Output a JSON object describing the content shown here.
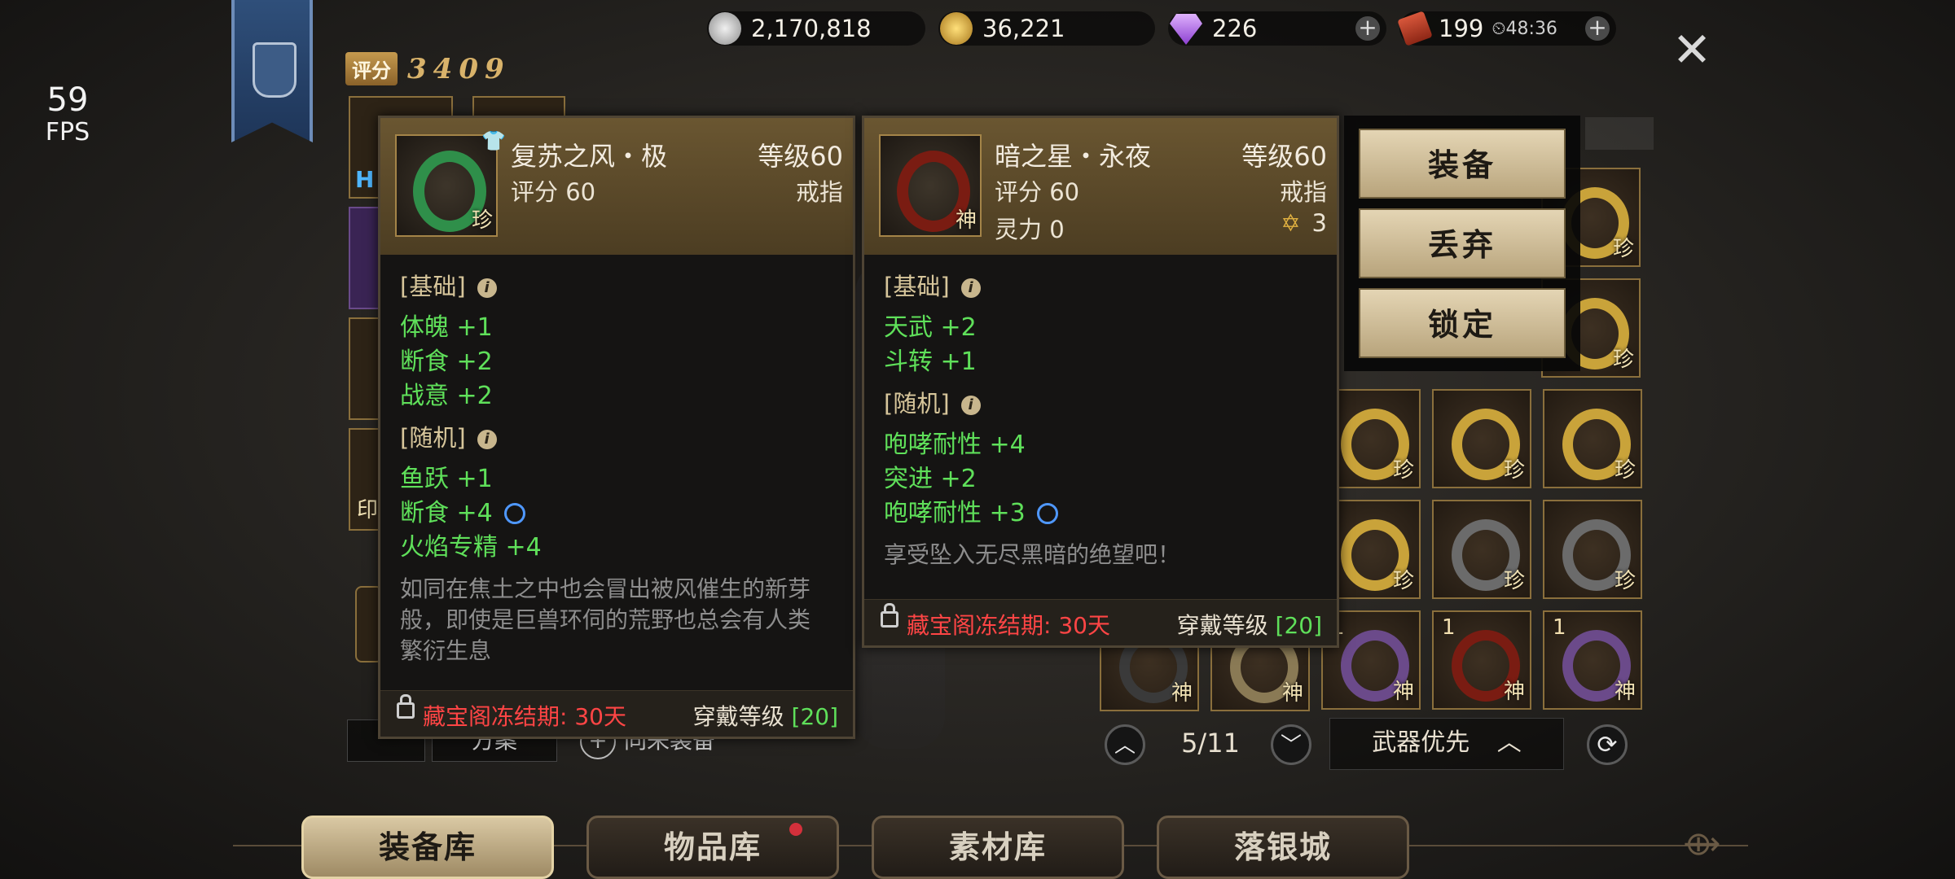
{
  "fps": {
    "value": "59",
    "unit": "FPS"
  },
  "currencies": [
    {
      "name": "silver-coin",
      "value": "2,170,818",
      "color": "#bdbdbd"
    },
    {
      "name": "gold-coin",
      "value": "36,221",
      "color": "#d4a530"
    },
    {
      "name": "diamond",
      "value": "226",
      "color": "#b276e8"
    },
    {
      "name": "stamina-ticket",
      "value": "199",
      "timer": "48:36",
      "color": "#c8422a"
    }
  ],
  "score": {
    "label": "评分",
    "value": "3409"
  },
  "left_partial": {
    "h_label": "H",
    "seal_label": "印",
    "plan_label": "方案",
    "sync_label": "同来装备"
  },
  "tooltip_left": {
    "name": "复苏之风・极",
    "level": "等级60",
    "score": "评分 60",
    "type": "戒指",
    "rarity": "珍",
    "ring_color": "#2f8f4a",
    "basic_title": "[基础]",
    "basic_stats": [
      "体魄 +1",
      "断食 +2",
      "战意 +2"
    ],
    "random_title": "[随机]",
    "random_stats": [
      "鱼跃 +1",
      "断食 +4",
      "火焰专精 +4"
    ],
    "description": "如同在焦土之中也会冒出被风催生的新芽般，即使是巨兽环伺的荒野也总会有人类繁衍生息",
    "freeze": "藏宝阁冻结期: 30天",
    "wear_label": "穿戴等级",
    "wear_level": "[20]"
  },
  "tooltip_right": {
    "name": "暗之星・永夜",
    "level": "等级60",
    "score": "评分 60",
    "type": "戒指",
    "spirit": "灵力 0",
    "stars": "3",
    "rarity": "神",
    "ring_color": "#7a1c12",
    "basic_title": "[基础]",
    "basic_stats": [
      "天武 +2",
      "斗转 +1"
    ],
    "random_title": "[随机]",
    "random_stats": [
      "咆哮耐性 +4",
      "突进 +2",
      "咆哮耐性 +3"
    ],
    "description": "享受坠入无尽黑暗的绝望吧！",
    "freeze": "藏宝阁冻结期: 30天",
    "wear_label": "穿戴等级",
    "wear_level": "[20]"
  },
  "actions": [
    "装备",
    "丢弃",
    "锁定"
  ],
  "inventory": [
    {
      "rarity": "珍",
      "color": "#c9a33a"
    },
    {
      "rarity": "珍",
      "color": "#c9a33a"
    },
    {
      "rarity": "珍",
      "color": "#c9a33a"
    },
    {
      "rarity": "珍",
      "color": "#c9a33a"
    },
    {
      "rarity": "珍",
      "color": "#6b6b6b"
    },
    {
      "rarity": "珍",
      "color": "#6b6b6b"
    },
    {
      "rarity": "神",
      "count": "1",
      "color": "#6b4a8a"
    },
    {
      "rarity": "神",
      "count": "1",
      "color": "#7a1c12"
    },
    {
      "rarity": "神",
      "count": "1",
      "color": "#6b4a8a"
    },
    {
      "rarity": "神",
      "color": "#3a3a3a"
    },
    {
      "rarity": "神",
      "color": "#8a7a55"
    }
  ],
  "right_col_top": [
    {
      "rarity": "珍",
      "color": "#c9a33a"
    },
    {
      "rarity": "珍",
      "color": "#c9a33a"
    }
  ],
  "pager": {
    "page": "5/11",
    "sort": "武器优先"
  },
  "tabs": [
    {
      "label": "装备库",
      "active": true
    },
    {
      "label": "物品库",
      "active": false,
      "badge": true
    },
    {
      "label": "素材库",
      "active": false
    },
    {
      "label": "落银城",
      "active": false
    }
  ]
}
